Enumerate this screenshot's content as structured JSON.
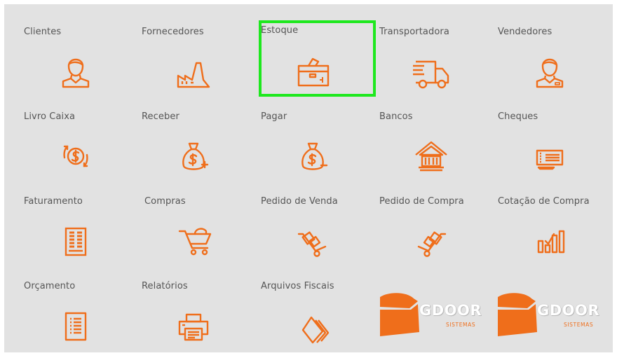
{
  "accent_color": "#ef6e1b",
  "selection_color": "#1ee81e",
  "tiles": {
    "clientes": {
      "label": "Clientes",
      "icon": "person-icon"
    },
    "fornecedores": {
      "label": "Fornecedores",
      "icon": "factory-icon"
    },
    "estoque": {
      "label": "Estoque",
      "icon": "box-icon"
    },
    "transportadora": {
      "label": "Transportadora",
      "icon": "truck-icon"
    },
    "vendedores": {
      "label": "Vendedores",
      "icon": "person-badge-icon"
    },
    "livro_caixa": {
      "label": "Livro Caixa",
      "icon": "coin-cycle-icon"
    },
    "receber": {
      "label": "Receber",
      "icon": "money-bag-plus-icon"
    },
    "pagar": {
      "label": "Pagar",
      "icon": "money-bag-minus-icon"
    },
    "bancos": {
      "label": "Bancos",
      "icon": "bank-icon"
    },
    "cheques": {
      "label": "Cheques",
      "icon": "check-icon"
    },
    "faturamento": {
      "label": "Faturamento",
      "icon": "invoice-icon"
    },
    "compras": {
      "label": "Compras",
      "icon": "cart-icon"
    },
    "pedido_venda": {
      "label": "Pedido de Venda",
      "icon": "hand-truck-icon"
    },
    "pedido_compra": {
      "label": "Pedido de Compra",
      "icon": "hand-truck-icon"
    },
    "cotacao_compra": {
      "label": "Cotação de Compra",
      "icon": "bar-chart-check-icon"
    },
    "orcamento": {
      "label": "Orçamento",
      "icon": "document-list-icon"
    },
    "relatorios": {
      "label": "Relatórios",
      "icon": "printer-icon"
    },
    "arquivos_fiscais": {
      "label": "Arquivos Fiscais",
      "icon": "stacked-files-icon"
    }
  },
  "logos": [
    {
      "brand": "GDOOR",
      "sub": "SISTEMAS"
    },
    {
      "brand": "GDOOR",
      "sub": "SISTEMAS"
    }
  ]
}
